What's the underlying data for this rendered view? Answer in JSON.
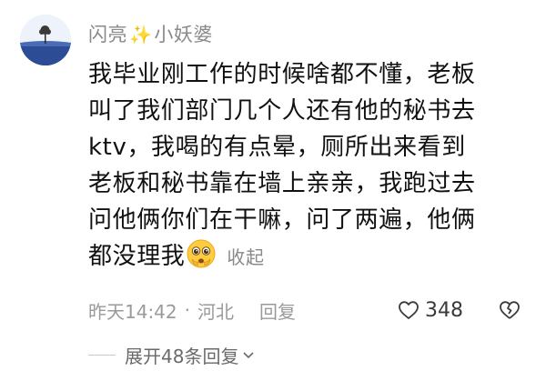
{
  "comment": {
    "username_part1": "闪亮",
    "username_sparkle": "✨",
    "username_part2": "小妖婆",
    "text_lines": [
      "我毕业刚工作的时候啥都不懂，老板",
      "叫了我们部门几个人还有他的秘书去",
      "ktv，我喝的有点晕，厕所出来看到",
      "老板和秘书靠在墙上亲亲，我跑过去",
      "问他俩你们在干嘛，问了两遍，他俩",
      "都没理我"
    ],
    "emoji": "pleading-face-icon",
    "collapse_label": "收起",
    "time": "昨天14:42",
    "separator": "·",
    "location": "河北",
    "reply_label": "回复",
    "like_count": "348",
    "expand_label": "展开48条回复"
  },
  "colors": {
    "text": "#111111",
    "secondary": "#8a8a8a",
    "sparkle": "#f2c230"
  }
}
